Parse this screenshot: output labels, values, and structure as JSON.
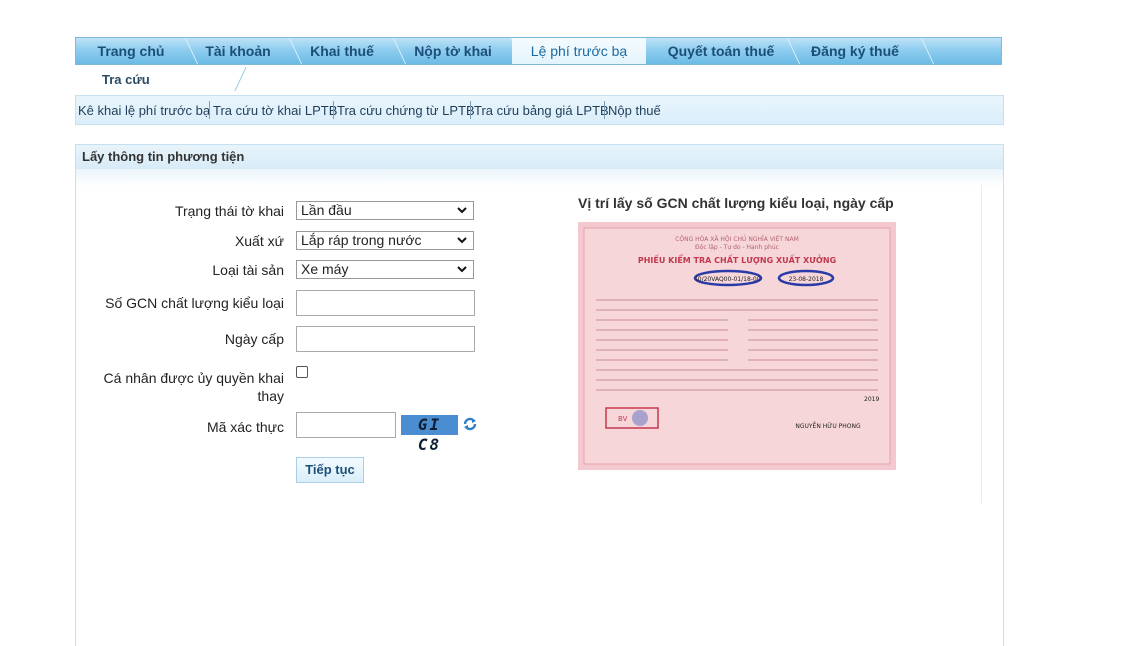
{
  "main_tabs": [
    {
      "label": "Trang chủ"
    },
    {
      "label": "Tài khoản"
    },
    {
      "label": "Khai thuế"
    },
    {
      "label": "Nộp tờ khai"
    },
    {
      "label": "Lệ phí trước bạ",
      "active": true
    },
    {
      "label": "Quyết toán thuế"
    },
    {
      "label": "Đăng ký thuế"
    }
  ],
  "sub_tab": {
    "label": "Tra cứu"
  },
  "submenu": [
    {
      "label": "Kê khai lệ phí trước bạ"
    },
    {
      "label": "Tra cứu tờ khai LPTB"
    },
    {
      "label": "Tra cứu chứng từ LPTB"
    },
    {
      "label": "Tra cứu bảng giá LPTB"
    },
    {
      "label": "Nộp thuế"
    }
  ],
  "panel": {
    "title": "Lấy thông tin phương tiện"
  },
  "form": {
    "status_label": "Trạng thái tờ khai",
    "status_value": "Lần đầu",
    "origin_label": "Xuất xứ",
    "origin_value": "Lắp ráp trong nước",
    "asset_type_label": "Loại tài sản",
    "asset_type_value": "Xe máy",
    "gcn_label": "Số GCN chất lượng kiểu loại",
    "gcn_value": "",
    "issue_date_label": "Ngày cấp",
    "issue_date_value": "",
    "authorized_label_line1": "Cá nhân được ủy quyền khai",
    "authorized_label_line2": "thay",
    "authorized_checked": false,
    "captcha_label": "Mã xác thực",
    "captcha_value": "",
    "captcha_text": "GI C8",
    "continue_label": "Tiếp tục"
  },
  "help": {
    "caption": "Vị trí lấy số GCN chất lượng kiểu loại, ngày cấp",
    "doc": {
      "l1": "CỘNG HÒA XÃ HỘI CHỦ NGHĨA VIỆT NAM",
      "l2": "Độc lập - Tự do - Hạnh phúc",
      "title": "PHIẾU KIỂM TRA CHẤT LƯỢNG XUẤT XƯỞNG",
      "gcn": "(0/20VAQ00-01/18-00",
      "date": "23-08-2018",
      "year": "2019",
      "signer": "NGUYỄN HỮU PHONG",
      "stamp": "BV"
    }
  },
  "colors": {
    "accent": "#1b6aa0",
    "tab_bg": "#8fcdef"
  },
  "icons": [
    "chevron-down-icon",
    "refresh-icon"
  ]
}
